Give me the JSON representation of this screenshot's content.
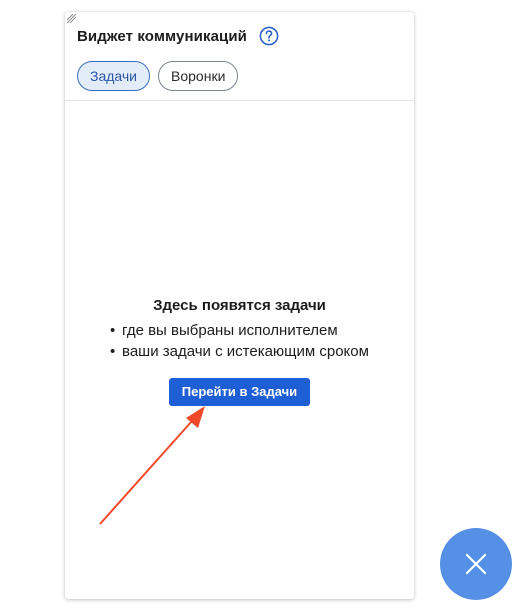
{
  "widget": {
    "title": "Виджет коммуникаций",
    "help_icon": "question-circle-icon",
    "tabs": [
      {
        "label": "Задачи",
        "active": true
      },
      {
        "label": "Воронки",
        "active": false
      }
    ]
  },
  "empty_state": {
    "title": "Здесь появятся задачи",
    "bullets": [
      "где вы выбраны исполнителем",
      "ваши задачи с истекающим сроком"
    ],
    "button_label": "Перейти в Задачи"
  },
  "fab": {
    "icon": "close-icon"
  },
  "colors": {
    "accent": "#1f5fd6",
    "tab_active_bg": "#e3edfa",
    "fab": "#5590e6",
    "arrow": "#f04a2a"
  }
}
